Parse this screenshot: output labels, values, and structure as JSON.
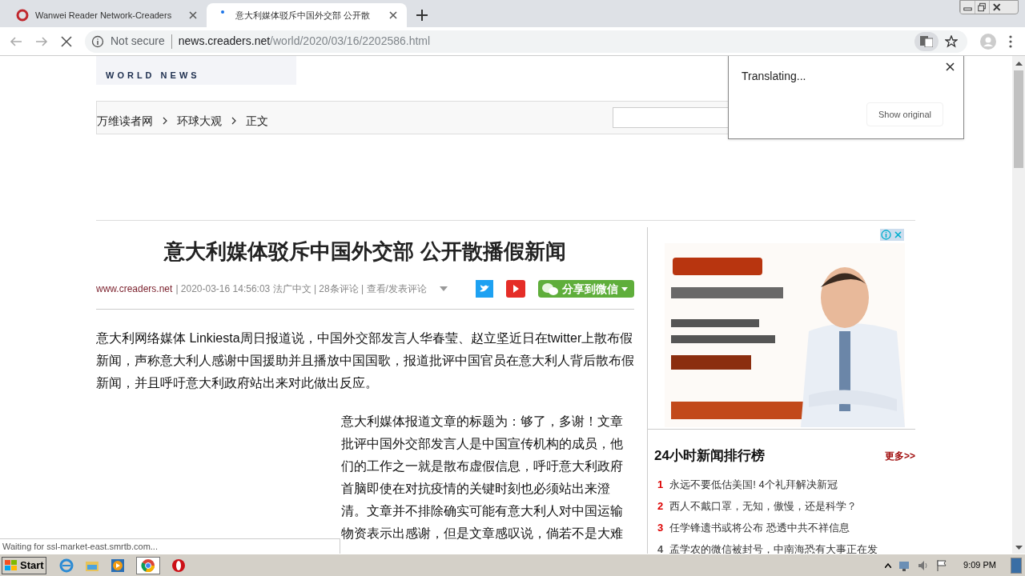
{
  "browser": {
    "tabs": [
      {
        "title": "Wanwei Reader Network-Creaders",
        "selected": false
      },
      {
        "title": "意大利媒体驳斥中国外交部 公开散",
        "selected": true
      }
    ],
    "address": {
      "security": "Not secure",
      "host": "news.creaders.net",
      "path": "/world/2020/03/16/2202586.html"
    },
    "loading": true
  },
  "page": {
    "logo": "WORLD NEWS",
    "breadcrumb": [
      "万维读者网",
      "环球大观",
      "正文"
    ],
    "article": {
      "title": "意大利媒体驳斥中国外交部 公开散播假新闻",
      "source": "www.creaders.net",
      "meta": "| 2020-03-16 14:56:03  法广中文 | 28条评论 | 查看/发表评论",
      "share": "分享到微信",
      "paragraphs": [
        "意大利网络媒体 Linkiesta周日报道说，中国外交部发言人华春莹、赵立坚近日在twitter上散布假新闻，声称意大利人感谢中国援助并且播放中国国歌，报道批评中国官员在意大利人背后散布假新闻，并且呼吁意大利政府站出来对此做出反应。",
        "意大利媒体报道文章的标题为：够了，多谢！文章批评中国外交部发言人是中国宣传机构的成员，他们的工作之一就是散布虚假信息，呼吁意大利政府首脑即使在对抗疫情的关键时刻也必须站出来澄清。文章并不排除确实可能有意大利人对中国运输物资表示出感谢，但是文章感叹说，倘若不是大难"
      ]
    },
    "ranking": {
      "title": "24小时新闻排行榜",
      "more": "更多>>",
      "items": [
        {
          "rank": "1",
          "text": "永远不要低估美国! 4个礼拜解决新冠"
        },
        {
          "rank": "2",
          "text": "西人不戴口罩，无知，傲慢，还是科学？"
        },
        {
          "rank": "3",
          "text": "任学锋遗书或将公布 恐透中共不祥信息"
        },
        {
          "rank": "4",
          "text": "孟学农的微信被封号，中南海恐有大事正在发"
        }
      ]
    }
  },
  "translate_popup": {
    "message": "Translating...",
    "button": "Show original"
  },
  "status_text": "Waiting for ssl-market-east.smrtb.com...",
  "taskbar": {
    "start": "Start",
    "clock": "9:09 PM"
  }
}
